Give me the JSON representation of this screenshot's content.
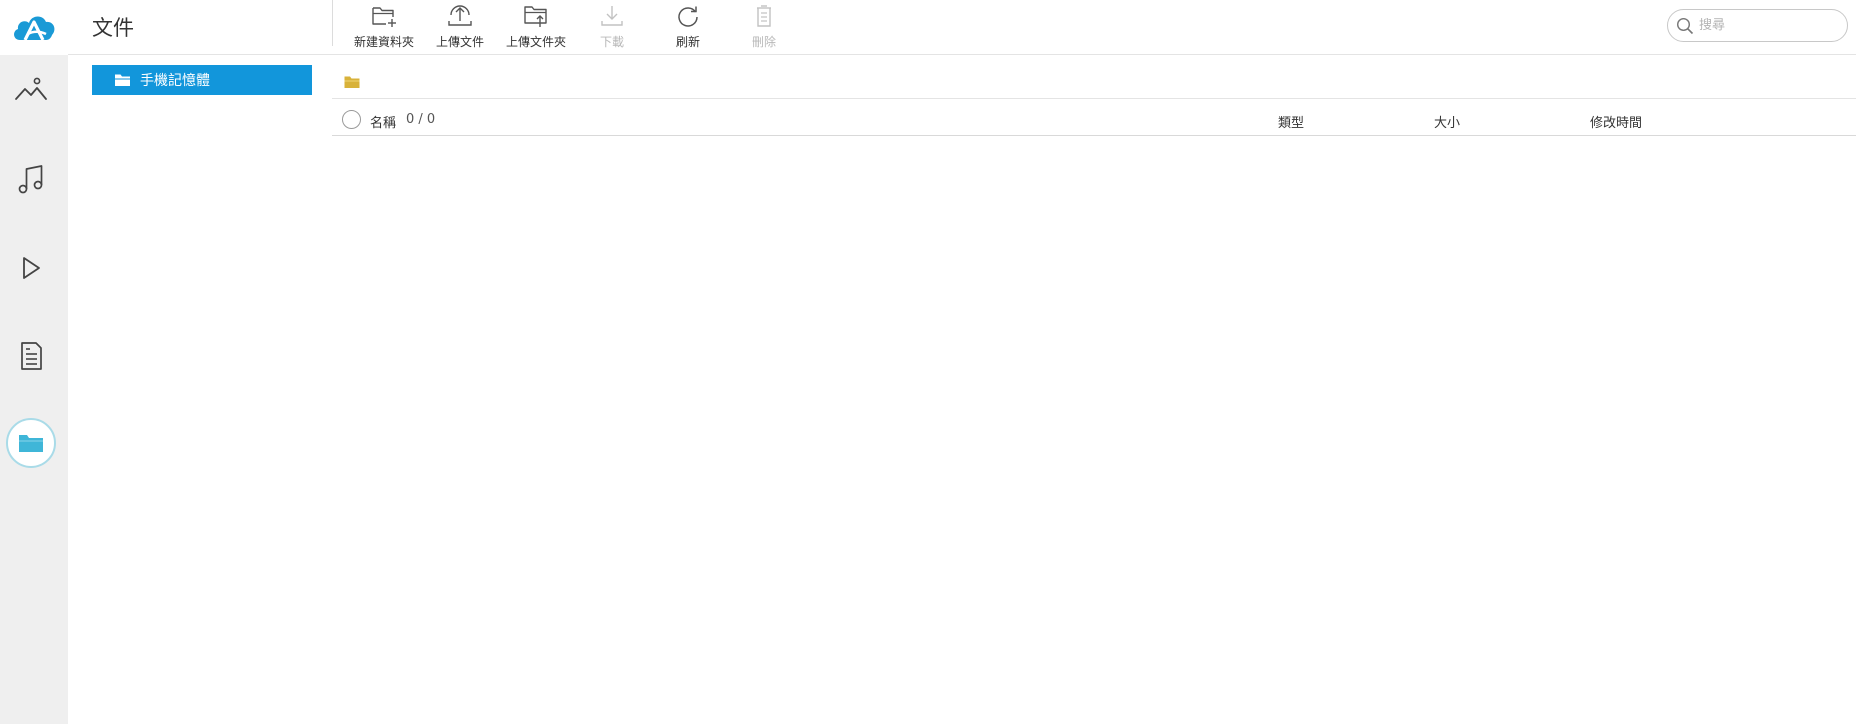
{
  "page": {
    "title": "文件"
  },
  "rail": {
    "items": [
      {
        "name": "photos",
        "icon": "photos-icon"
      },
      {
        "name": "music",
        "icon": "music-icon"
      },
      {
        "name": "video",
        "icon": "play-icon"
      },
      {
        "name": "documents",
        "icon": "document-icon"
      },
      {
        "name": "files",
        "icon": "folder-icon",
        "active": true
      }
    ]
  },
  "toolbar": {
    "new_folder": "新建資料夾",
    "upload_file": "上傳文件",
    "upload_folder": "上傳文件夾",
    "download": "下載",
    "refresh": "刷新",
    "delete": "刪除"
  },
  "search": {
    "placeholder": "搜尋"
  },
  "sidebar": {
    "storage_label": "手機記憶體"
  },
  "table": {
    "columns": {
      "name": "名稱",
      "type": "類型",
      "size": "大小",
      "modified": "修改時間"
    },
    "selection_count": "0 / 0"
  },
  "colors": {
    "accent": "#1296db",
    "rail_background": "#efefef",
    "folder_yellow": "#d8b23a",
    "active_folder": "#3fb6d8",
    "disabled": "#b8b8b8"
  }
}
